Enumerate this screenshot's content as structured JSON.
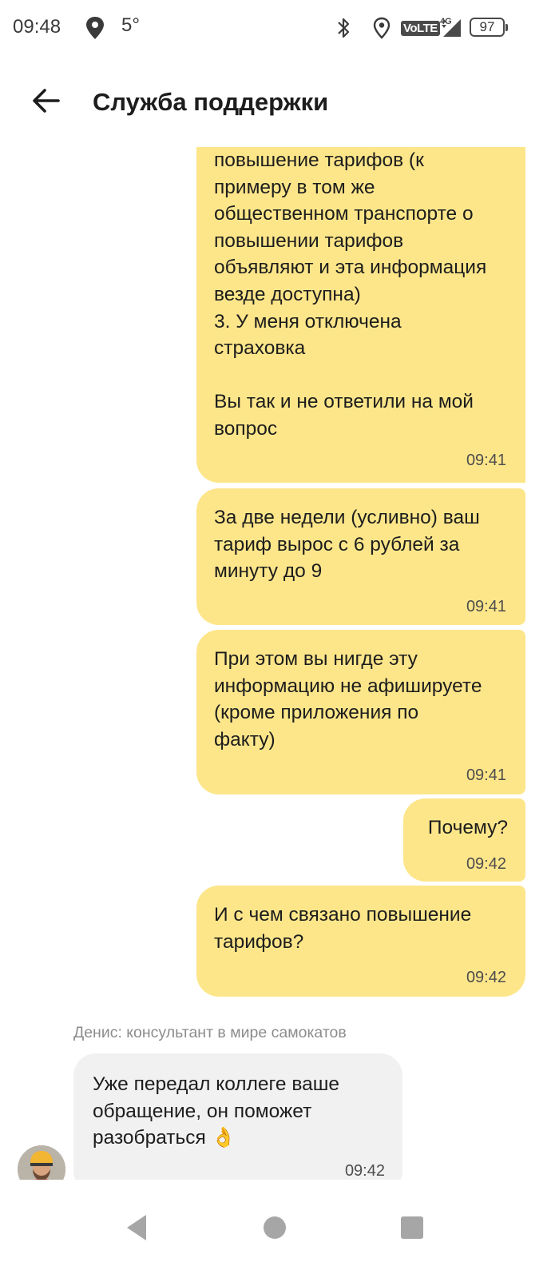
{
  "status_bar": {
    "time": "09:48",
    "temperature": "5°",
    "network": "VoLTE",
    "network_gen": "4G",
    "battery": "97",
    "icons": [
      "location-icon",
      "bluetooth-icon",
      "gps-icon",
      "signal-icon",
      "battery-icon"
    ]
  },
  "header": {
    "title": "Служба поддержки",
    "back_icon": "arrow-left-icon"
  },
  "messages_out": [
    {
      "text": "повышение тарифов (к\nпримеру в том же\nобщественном транспорте о\nповышении тарифов\nобъявляют и эта информация\nвезде доступна)\n3. У меня отключена\nстраховка\n\nВы так и не ответили на мой\nвопрос",
      "time": "09:41"
    },
    {
      "text": "За две недели (усливно) ваш\nтариф вырос с 6 рублей за\nминуту до 9",
      "time": "09:41"
    },
    {
      "text": "При этом вы нигде эту\nинформацию не афишируете\n(кроме приложения по\nфакту)",
      "time": "09:41"
    },
    {
      "text": "Почему?",
      "time": "09:42"
    },
    {
      "text": "И с чем связано повышение\nтарифов?",
      "time": "09:42"
    }
  ],
  "message_in": {
    "sender": "Денис: консультант в мире самокатов",
    "text": "Уже передал коллеге ваше\nобращение, он поможет\nразобраться 👌",
    "time": "09:42",
    "avatar_icon": "agent-avatar"
  },
  "nav_bar": {
    "icons": [
      "nav-back-icon",
      "nav-home-icon",
      "nav-recent-icon"
    ]
  },
  "colors": {
    "outgoing_bubble": "#fde68a",
    "incoming_bubble": "#f1f1f1",
    "text": "#1d1d1d",
    "meta_text": "#8c8c8c"
  }
}
